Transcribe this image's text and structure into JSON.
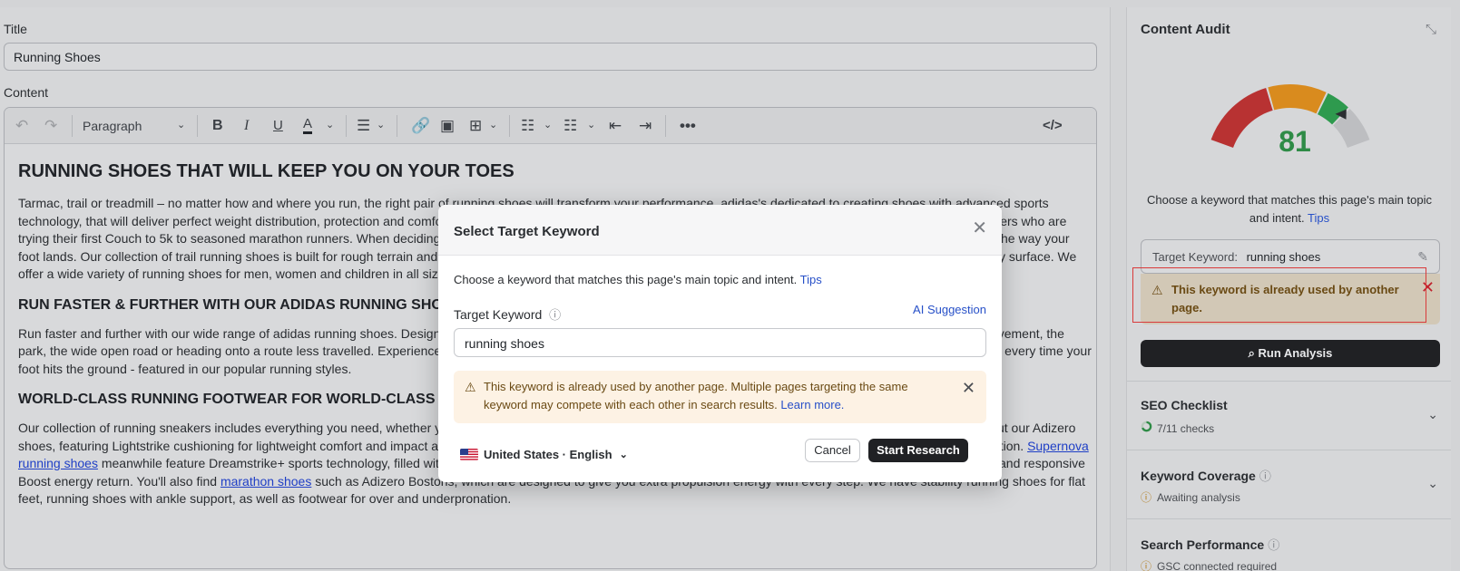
{
  "editor": {
    "title_label": "Title",
    "title_value": "Running Shoes",
    "content_label": "Content",
    "toolbar": {
      "block_format": "Paragraph",
      "icons": [
        "undo-icon",
        "redo-icon",
        "bold-icon",
        "italic-icon",
        "underline-icon",
        "text-color-icon",
        "align-icon",
        "link-icon",
        "image-icon",
        "table-icon",
        "bullet-list-icon",
        "numbered-list-icon",
        "outdent-icon",
        "indent-icon",
        "more-icon",
        "code-view-icon"
      ]
    },
    "doc": {
      "h1": "RUNNING SHOES THAT WILL KEEP YOU ON YOUR TOES",
      "p1": "Tarmac, trail or treadmill – no matter how and where you run, the right pair of running shoes will transform your performance. adidas's dedicated to creating shoes with advanced sports technology, that will deliver perfect weight distribution, protection and comfort run after run. Our wide range of running footwear accommodates everyone, from absolute beginners who are trying their first Couch to 5k to seasoned marathon runners. When deciding which running shoes to buy, be sure to choose a pair that suits your preferred running surface and the way your foot lands. Our collection of trail running shoes is built for rough terrain and the range also features versatile all-round shoes if you prefer to mix things up and try running on any surface. We offer a wide variety of running shoes for men, women and children in all sizes and for all abilities.",
      "h2a": "RUN FASTER & FURTHER WITH OUR ADIDAS RUNNING SHOES",
      "p2": "Run faster and further with our wide range of adidas running shoes. Designed with runners in mind, our shoes combine comfort and performance, whether you're hitting the pavement, the park, the wide open road or heading onto a route less travelled. Experience maximum energy return with our Boost cushioning, its energy capsules that unleash endless power every time your foot hits the ground - featured in our popular running styles.",
      "h2b": "WORLD-CLASS RUNNING FOOTWEAR FOR WORLD-CLASS RUNNERS",
      "p3_a": "Our collection of running sneakers includes everything you need, whether you're training for your first race, chasing a personal best or you're a gym bunny. For racing, check out our Adizero shoes, featuring Lightstrike cushioning for lightweight comfort and impact absorption, energy rods that help to limit energy loss and Continental Rubber outsoles for superb traction. ",
      "p3_link1": "Supernova running shoes",
      "p3_b": " meanwhile feature Dreamstrike+ sports technology, filled with specially engineered super foam for softer impacts, Stretchweb outsoles that adapt to your stride, and responsive Boost energy return. You'll also find ",
      "p3_link2": "marathon shoes",
      "p3_c": " such as Adizero Bostons, which are designed to give you extra propulsion energy with every step. We have stability running shoes for flat feet, running shoes with ankle support, as well as footwear for over and underpronation."
    }
  },
  "audit": {
    "title": "Content Audit",
    "score": "81",
    "score_fraction": 0.81,
    "gauge_colors": {
      "red": "#b83232",
      "orange": "#d98b1e",
      "green": "#2e9a4e",
      "grey": "#bdbec1"
    },
    "desc": "Choose a keyword that matches this page's main topic and intent.",
    "desc_link": "Tips",
    "target_keyword_label": "Target Keyword:",
    "target_keyword_value": "running shoes",
    "warning": "This keyword is already used by another page.",
    "run_button": "Run Analysis",
    "sections": [
      {
        "title": "SEO Checklist",
        "sub": "7/11 checks",
        "has_help": false
      },
      {
        "title": "Keyword Coverage",
        "sub": "Awaiting analysis",
        "has_help": true
      },
      {
        "title": "Search Performance",
        "sub": "GSC connected required",
        "has_help": true
      }
    ]
  },
  "modal": {
    "title": "Select Target Keyword",
    "desc": "Choose a keyword that matches this page's main topic and intent.",
    "desc_link": "Tips",
    "field_label": "Target Keyword",
    "ai_suggestion": "AI Suggestion",
    "input_value": "running shoes",
    "warning_text": "This keyword is already used by another page. Multiple pages targeting the same keyword may compete with each other in search results.",
    "warning_link": "Learn more.",
    "locale": "United States · English",
    "cancel": "Cancel",
    "start": "Start Research"
  }
}
